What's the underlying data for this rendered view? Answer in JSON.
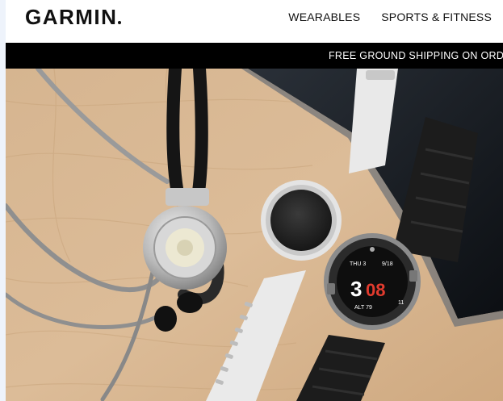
{
  "brand": {
    "logo_text": "GARMIN"
  },
  "nav": {
    "items": [
      {
        "label": "WEARABLES"
      },
      {
        "label": "SPORTS & FITNESS"
      }
    ]
  },
  "promo": {
    "text": "FREE GROUND SHIPPING ON ORDE"
  },
  "hero": {
    "watch_display": {
      "big_number": "3",
      "red_number": "08",
      "top_left": "THU 3",
      "top_right": "9/18",
      "bottom_label": "ALT 79",
      "right_label": "11"
    }
  },
  "colors": {
    "header_bg": "#ffffff",
    "promo_bg": "#000000",
    "promo_text": "#ffffff",
    "wood": "#d9b894",
    "watch_red": "#e23b2e"
  }
}
